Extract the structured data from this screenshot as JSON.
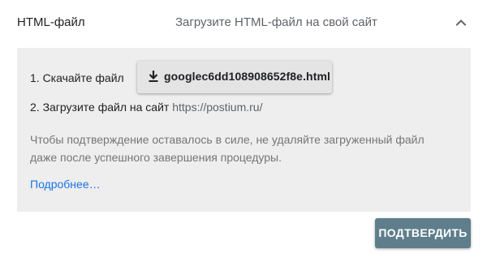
{
  "method": {
    "title": "HTML-файл",
    "subtitle": "Загрузите HTML-файл на свой сайт",
    "collapse_icon": "chevron-up-icon"
  },
  "steps": {
    "step1_label": "1. Скачайте файл",
    "download_filename": "googlec6dd108908652f8e.html",
    "download_icon": "download-icon",
    "step2_label": "2. Загрузите файл на сайт",
    "step2_url": "https://postium.ru/"
  },
  "note": "Чтобы подтверждение оставалось в силе, не удаляйте загруженный файл даже после успешного завершения процедуры.",
  "more_link": "Подробнее…",
  "confirm_label": "ПОДТВЕРДИТЬ",
  "colors": {
    "panel_bg": "#eeeeee",
    "confirm_bg": "#5f7e8c",
    "link": "#1a73e8"
  }
}
